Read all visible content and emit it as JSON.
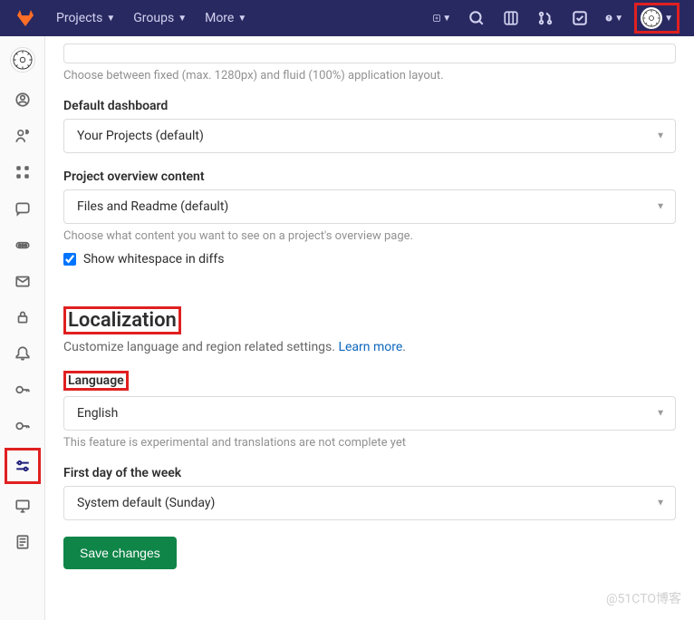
{
  "topnav": {
    "items": [
      "Projects",
      "Groups",
      "More"
    ]
  },
  "layout": {
    "help_text": "Choose between fixed (max. 1280px) and fluid (100%) application layout."
  },
  "dashboard": {
    "label": "Default dashboard",
    "value": "Your Projects (default)"
  },
  "overview": {
    "label": "Project overview content",
    "value": "Files and Readme (default)",
    "help_text": "Choose what content you want to see on a project's overview page."
  },
  "whitespace": {
    "label": "Show whitespace in diffs"
  },
  "localization": {
    "title": "Localization",
    "subtitle": "Customize language and region related settings.",
    "learn_more": "Learn more"
  },
  "language": {
    "label": "Language",
    "value": "English",
    "help_text": "This feature is experimental and translations are not complete yet"
  },
  "first_day": {
    "label": "First day of the week",
    "value": "System default (Sunday)"
  },
  "save_button": "Save changes",
  "watermark": "@51CTO博客"
}
